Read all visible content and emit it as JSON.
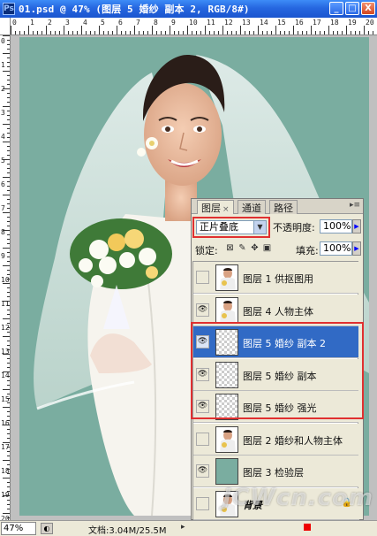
{
  "window": {
    "title": "01.psd @ 47% (图层 5 婚纱 副本 2, RGB/8#)",
    "app_icon_label": "Ps",
    "minimize": "_",
    "maximize": "□",
    "close": "X"
  },
  "rulers": {
    "horizontal": [
      "0",
      "1",
      "2",
      "3",
      "4",
      "5",
      "6",
      "7",
      "8",
      "9",
      "10",
      "11",
      "12",
      "13",
      "14",
      "15",
      "16",
      "17",
      "18",
      "19",
      "20"
    ],
    "vertical": [
      "0",
      "1",
      "2",
      "3",
      "4",
      "5",
      "6",
      "7",
      "8",
      "9",
      "10",
      "11",
      "12",
      "13",
      "14",
      "15",
      "16",
      "17",
      "18",
      "19",
      "20"
    ]
  },
  "panel": {
    "tabs": [
      {
        "label": "图层",
        "close": "×",
        "active": true
      },
      {
        "label": "通道",
        "active": false
      },
      {
        "label": "路径",
        "active": false
      }
    ],
    "menu_glyph": "▸≡",
    "blend_mode": "正片叠底",
    "opacity_label": "不透明度:",
    "opacity_value": "100%",
    "lock_label": "锁定:",
    "fill_label": "填充:",
    "fill_value": "100%",
    "lock_icons": [
      "lock-transparent-icon",
      "lock-paint-icon",
      "lock-move-icon",
      "lock-all-icon"
    ],
    "layers": [
      {
        "name": "图层 1  供抠图用",
        "visible": false,
        "thumb": "photo",
        "selected": false
      },
      {
        "name": "图层 4  人物主体",
        "visible": true,
        "thumb": "photo",
        "selected": false
      },
      {
        "name": "图层 5 婚纱 副本 2",
        "visible": true,
        "thumb": "checker",
        "selected": true
      },
      {
        "name": "图层 5 婚纱 副本",
        "visible": true,
        "thumb": "checker",
        "selected": false
      },
      {
        "name": "图层 5 婚纱  强光",
        "visible": true,
        "thumb": "checker",
        "selected": false
      },
      {
        "name": "图层 2  婚纱和人物主体",
        "visible": false,
        "thumb": "photo",
        "selected": false
      },
      {
        "name": "图层 3  检验层",
        "visible": true,
        "thumb": "solid",
        "selected": false
      },
      {
        "name": "背景",
        "visible": false,
        "thumb": "photo",
        "selected": false,
        "italic": true,
        "locked": true
      }
    ]
  },
  "status": {
    "zoom": "47%",
    "doc_info": "文档:3.04M/25.5M",
    "arrow": "▸"
  },
  "watermark": "JCWcn.com 中国教程网",
  "watermark_text": "JCWcn.com"
}
